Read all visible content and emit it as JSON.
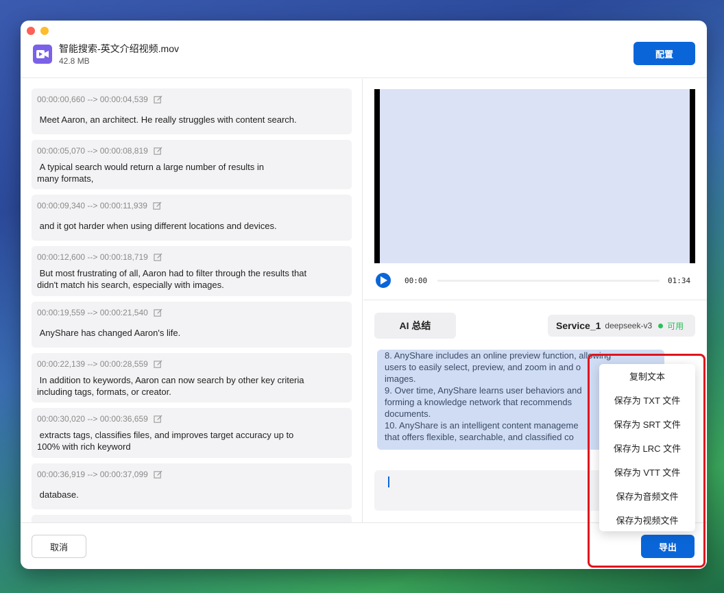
{
  "header": {
    "file_name": "智能搜索-英文介绍视频.mov",
    "file_size": "42.8 MB",
    "config_label": "配置"
  },
  "segments": [
    {
      "time": "00:00:00,660 --> 00:00:04,539",
      "text": "Meet Aaron, an architect. He really struggles with content search."
    },
    {
      "time": "00:00:05,070 --> 00:00:08,819",
      "text": "A typical search would return a large number of results in",
      "text2": "many formats,"
    },
    {
      "time": "00:00:09,340 --> 00:00:11,939",
      "text": "and it got harder when using different locations and devices."
    },
    {
      "time": "00:00:12,600 --> 00:00:18,719",
      "text": "But most frustrating of all, Aaron had to filter through the results that",
      "text2": "didn't match his search, especially with images."
    },
    {
      "time": "00:00:19,559 --> 00:00:21,540",
      "text": "AnyShare has changed Aaron's life."
    },
    {
      "time": "00:00:22,139 --> 00:00:28,559",
      "text": "In addition to keywords, Aaron can now search by other key criteria",
      "text2": "including tags, formats, or creator."
    },
    {
      "time": "00:00:30,020 --> 00:00:36,659",
      "text": "extracts tags, classifies files, and improves target accuracy up to",
      "text2": "100% with rich keyword"
    },
    {
      "time": "00:00:36,919 --> 00:00:37,099",
      "text": "database."
    }
  ],
  "player": {
    "current_time": "00:00",
    "total_time": "01:34",
    "progress": 0
  },
  "ai": {
    "summary_label": "AI 总结",
    "service_name": "Service_1",
    "model": "deepseek-v3",
    "status": "可用",
    "summary_lines": [
      "8. AnyShare includes an online preview function, allowing",
      "users to easily select, preview, and zoom in and o",
      "images.",
      "9. Over time, AnyShare learns user behaviors and",
      "forming a knowledge network that recommends",
      "documents.",
      "10. AnyShare is an intelligent content manageme",
      "that offers flexible, searchable, and classified co"
    ]
  },
  "export_menu": [
    "复制文本",
    "保存为 TXT 文件",
    "保存为 SRT 文件",
    "保存为 LRC 文件",
    "保存为 VTT 文件",
    "保存为音频文件",
    "保存为视频文件"
  ],
  "footer": {
    "cancel_label": "取消",
    "export_label": "导出"
  },
  "colors": {
    "primary": "#0a66d8",
    "available": "#2dbf5a",
    "highlight": "#e0141c"
  }
}
